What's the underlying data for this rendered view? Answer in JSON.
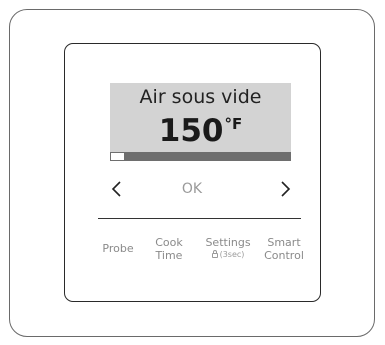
{
  "display": {
    "mode": "Air sous vide",
    "temperature": "150",
    "unit": "°F",
    "progress_fraction": 0.07
  },
  "navigation": {
    "prev_icon": "‹",
    "ok_label": "OK",
    "next_icon": "›"
  },
  "controls": {
    "probe": "Probe",
    "cook_time_line1": "Cook",
    "cook_time_line2": "Time",
    "settings": "Settings",
    "settings_hint": "(3sec)",
    "smart_control_line1": "Smart",
    "smart_control_line2": "Control"
  },
  "colors": {
    "screen_bg": "#d3d3d3",
    "progress_track": "#6e6e6e",
    "inactive_text": "#8a8a8a"
  }
}
